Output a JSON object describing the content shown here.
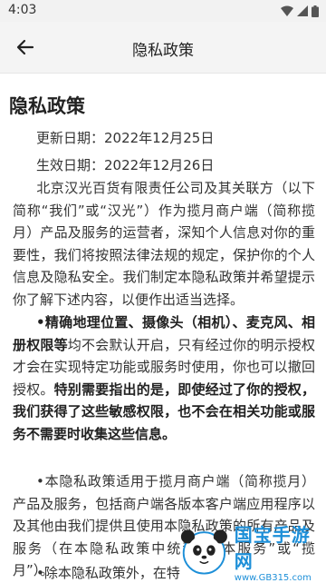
{
  "status_bar": {
    "time": "4:03"
  },
  "app_bar": {
    "title": "隐私政策"
  },
  "document": {
    "title": "隐私政策",
    "updated": "更新日期：2022年12月25日",
    "effective": "生效日期：2022年12月26日",
    "p1": "北京汉光百货有限责任公司及其关联方（以下简称“我们”或“汉光”）作为揽月商户端（简称揽月）产品及服务的运营者，深知个人信息对你的重要性，我们将按照法律法规的规定，保护你的个人信息及隐私安全。我们制定本隐私政策并希望提示你了解下述内容，以便作出适当选择。",
    "p2_bold1": "•精确地理位置、摄像头（相机）、麦克风、相册权限等",
    "p2_text1": "均不会默认开启，只有经过你的明示授权才会在实现特定功能或服务时使用，你也可以撤回授权。",
    "p2_bold2": "特别需要指出的是，即使经过了你的授权，我们获得了这些敏感权限，也不会在相关功能或服务不需要时收集这些信息。",
    "p3": "•本隐私政策适用于揽月商户端（简称揽月）产品及服务，包括商户端各版本客户端应用程序以及其他由我们提供且使用本隐私政策的所有产品及服务（在本隐私政策中统称为“本服务”或“揽月”）。",
    "p4": "•除本隐私政策外，在特"
  },
  "watermark": {
    "name": "国宝手游网",
    "url": "www.GB315.com"
  },
  "colors": {
    "status_bg": "#f2f2f2",
    "appbar_bg": "#f4f4f4",
    "text": "#333333",
    "watermark": "#1d8fd8"
  }
}
